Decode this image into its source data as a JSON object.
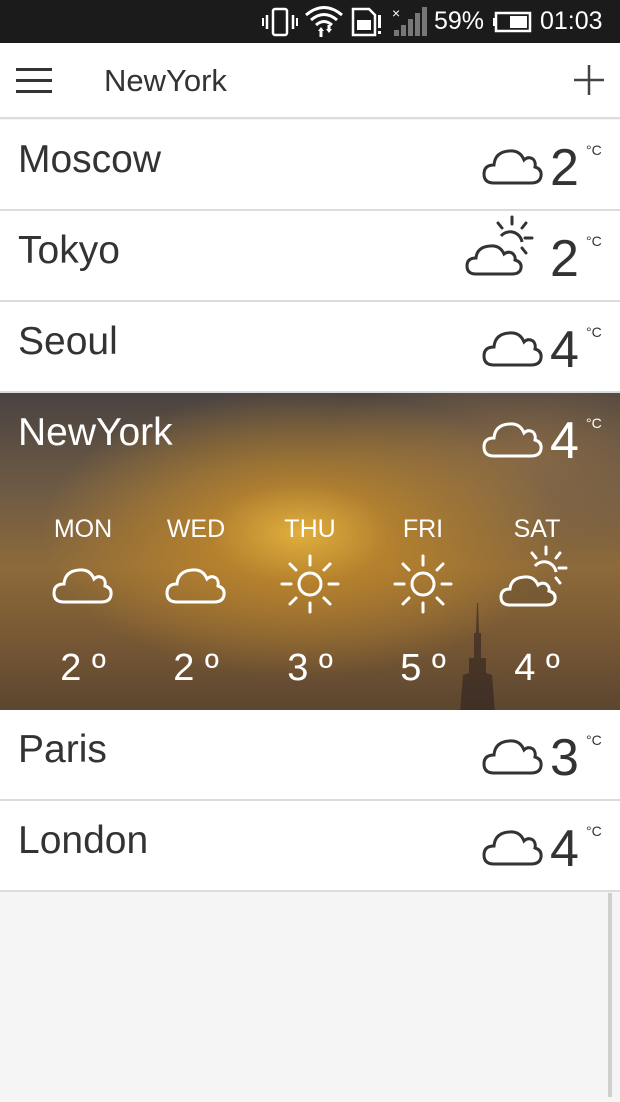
{
  "status_bar": {
    "battery_percent": "59%",
    "time": "01:03",
    "icons": [
      "vibrate-icon",
      "wifi-icon",
      "sim-icon",
      "signal-icon",
      "battery-icon"
    ]
  },
  "app_bar": {
    "title": "NewYork",
    "menu_icon": "hamburger-menu-icon",
    "add_icon": "plus-icon"
  },
  "unit": "°C",
  "cities": [
    {
      "name": "Moscow",
      "temp": "2",
      "icon": "cloud-icon"
    },
    {
      "name": "Tokyo",
      "temp": "2",
      "icon": "partly-cloudy-icon"
    },
    {
      "name": "Seoul",
      "temp": "4",
      "icon": "cloud-icon"
    },
    {
      "name": "NewYork",
      "temp": "4",
      "icon": "cloud-icon",
      "forecast": [
        {
          "day": "MON",
          "icon": "cloud-icon",
          "temp": "2 º"
        },
        {
          "day": "WED",
          "icon": "cloud-icon",
          "temp": "2 º"
        },
        {
          "day": "THU",
          "icon": "sun-icon",
          "temp": "3 º"
        },
        {
          "day": "FRI",
          "icon": "sun-icon",
          "temp": "5 º"
        },
        {
          "day": "SAT",
          "icon": "partly-cloudy-icon",
          "temp": "4 º"
        }
      ]
    },
    {
      "name": "Paris",
      "temp": "3",
      "icon": "cloud-icon"
    },
    {
      "name": "London",
      "temp": "4",
      "icon": "cloud-icon"
    }
  ],
  "colors": {
    "status_bar": "#1b1b1b",
    "text": "#333333",
    "divider": "#dcdcdc"
  }
}
